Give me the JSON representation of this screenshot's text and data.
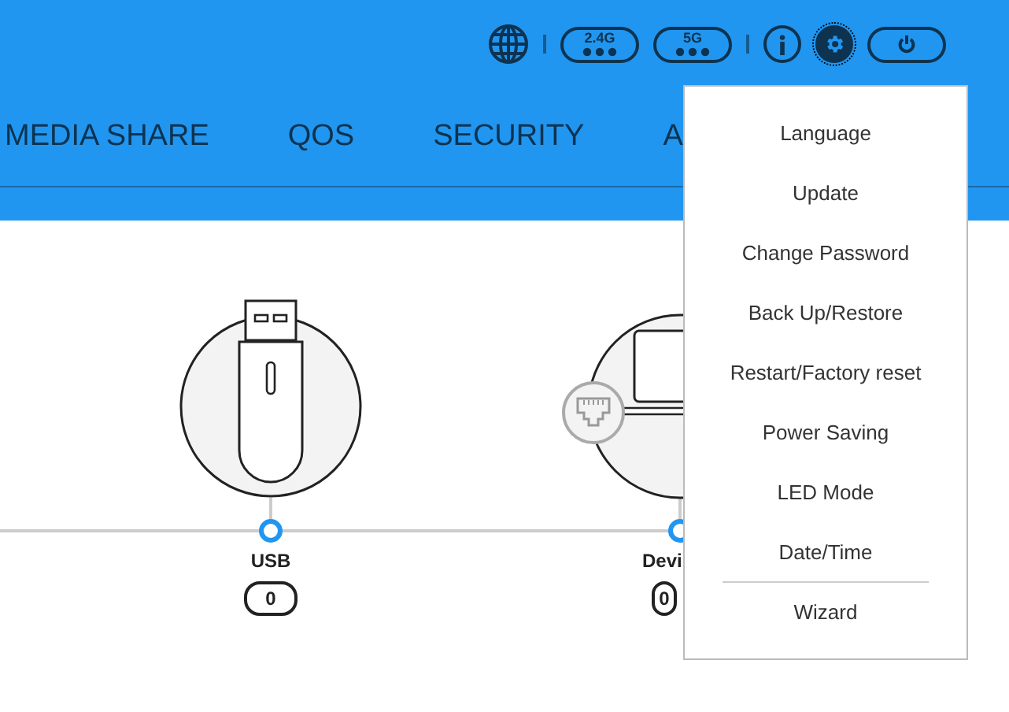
{
  "toolbar": {
    "band_24": "2.4G",
    "band_5": "5G",
    "settings_active": true
  },
  "nav": {
    "items": [
      "MEDIA SHARE",
      "QOS",
      "SECURITY",
      "A"
    ]
  },
  "diagram": {
    "nodes": [
      {
        "kind": "usb",
        "label": "USB",
        "count": "0"
      },
      {
        "kind": "device",
        "label": "Devi",
        "count": "0"
      }
    ]
  },
  "menu": {
    "items": [
      {
        "label": "Language",
        "divider_before": false
      },
      {
        "label": "Update",
        "divider_before": false
      },
      {
        "label": "Change Password",
        "divider_before": false
      },
      {
        "label": "Back Up/Restore",
        "divider_before": false
      },
      {
        "label": "Restart/Factory reset",
        "divider_before": false
      },
      {
        "label": "Power Saving",
        "divider_before": false
      },
      {
        "label": "LED Mode",
        "divider_before": false
      },
      {
        "label": "Date/Time",
        "divider_before": false
      },
      {
        "label": "Wizard",
        "divider_before": true
      }
    ]
  }
}
